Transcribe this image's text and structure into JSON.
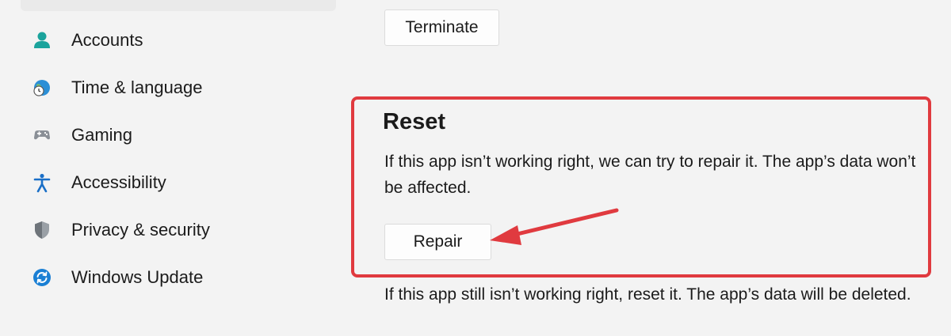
{
  "sidebar": {
    "items": [
      {
        "label": "Accounts",
        "icon": "person-icon"
      },
      {
        "label": "Time & language",
        "icon": "globe-clock-icon"
      },
      {
        "label": "Gaming",
        "icon": "gamepad-icon"
      },
      {
        "label": "Accessibility",
        "icon": "accessibility-icon"
      },
      {
        "label": "Privacy & security",
        "icon": "shield-icon"
      },
      {
        "label": "Windows Update",
        "icon": "update-icon"
      }
    ]
  },
  "main": {
    "terminate_label": "Terminate",
    "reset": {
      "title": "Reset",
      "repair_description": "If this app isn’t working right, we can try to repair it. The app’s data won’t be affected.",
      "repair_label": "Repair",
      "reset_description": "If this app still isn’t working right, reset it. The app’s data will be deleted."
    }
  },
  "colors": {
    "highlight": "#e03a3f",
    "accent": "#1a6fc7",
    "background": "#f3f3f3"
  }
}
